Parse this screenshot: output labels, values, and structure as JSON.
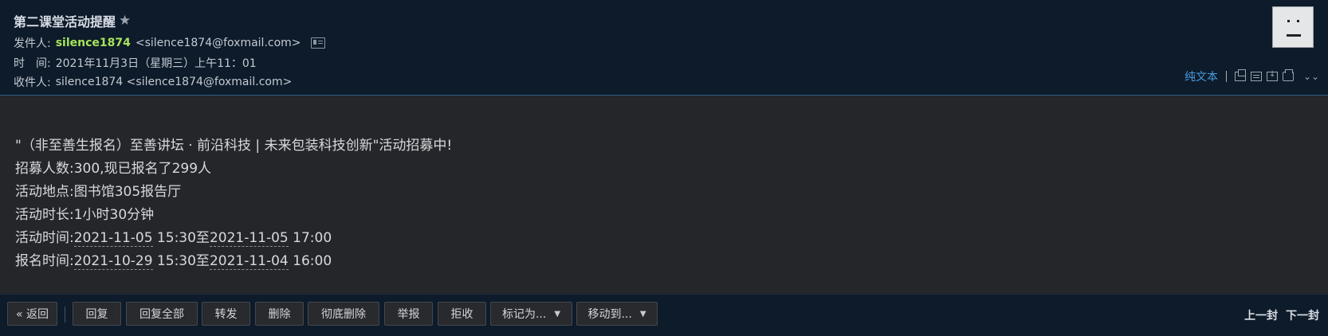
{
  "header": {
    "subject": "第二课堂活动提醒",
    "from_label": "发件人:",
    "from_name": "silence1874",
    "from_addr": "<silence1874@foxmail.com>",
    "time_label": "时　间:",
    "time_value": "2021年11月3日（星期三）上午11：01",
    "to_label": "收件人:",
    "to_value": "silence1874 <silence1874@foxmail.com>",
    "plain_text": "纯文本"
  },
  "body": {
    "lines": [
      "\"（非至善生报名）至善讲坛 · 前沿科技 | 未来包装科技创新\"活动招募中!",
      "招募人数:300,现已报名了299人",
      "活动地点:图书馆305报告厅",
      "活动时长:1小时30分钟"
    ],
    "activity_time_label": "活动时间:",
    "activity_time_start_date": "2021-11-05",
    "activity_time_start_time": " 15:30至",
    "activity_time_end_date": "2021-11-05",
    "activity_time_end_time": " 17:00",
    "signup_time_label": "报名时间:",
    "signup_time_start_date": "2021-10-29",
    "signup_time_start_time": " 15:30至",
    "signup_time_end_date": "2021-11-04",
    "signup_time_end_time": " 16:00"
  },
  "toolbar": {
    "back": "« 返回",
    "reply": "回复",
    "reply_all": "回复全部",
    "forward": "转发",
    "delete": "删除",
    "delete_permanent": "彻底删除",
    "report": "举报",
    "reject": "拒收",
    "mark_as": "标记为...",
    "move_to": "移动到...",
    "prev": "上一封",
    "next": "下一封"
  }
}
